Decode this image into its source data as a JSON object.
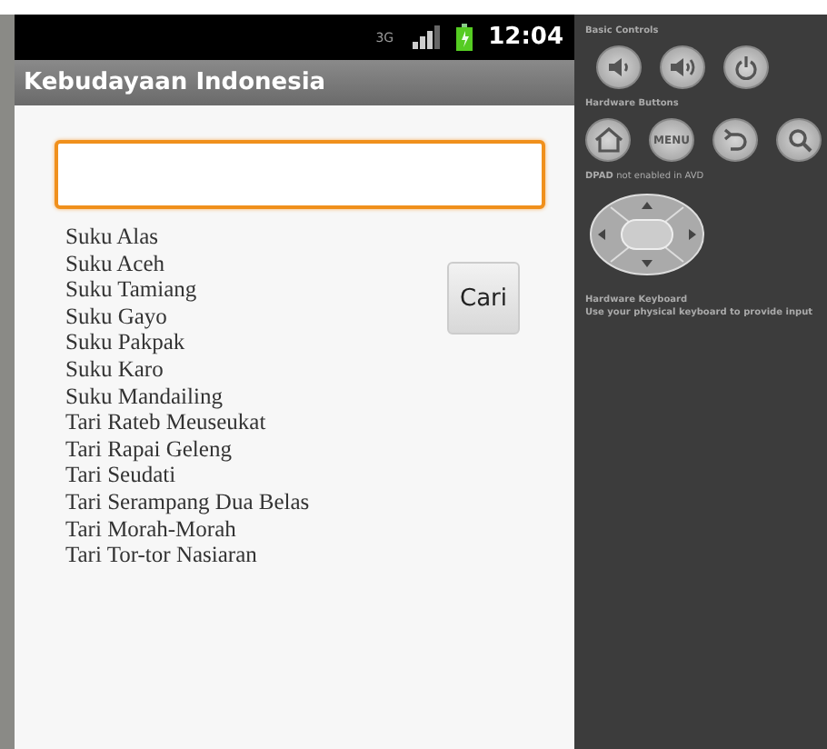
{
  "status_bar": {
    "time": "12:04",
    "network": "3G"
  },
  "app_bar": {
    "title": "Kebudayaan Indonesia"
  },
  "search": {
    "focused": true
  },
  "search_button": {
    "label": "Cari"
  },
  "items": [
    "Suku Alas",
    "Suku Aceh",
    "Suku Tamiang",
    "Suku Gayo",
    "Suku Pakpak",
    "Suku Karo",
    "Suku Mandailing",
    "Tari Rateb Meuseukat",
    "Tari Rapai Geleng",
    "Tari Seudati",
    "Tari Serampang Dua Belas",
    "Tari Morah-Morah",
    "Tari Tor-tor Nasiaran"
  ],
  "controls_panel": {
    "basic_controls": {
      "label": "Basic Controls"
    },
    "hardware_buttons": {
      "label": "Hardware Buttons",
      "menu_label": "MENU"
    },
    "dpad": {
      "label_bold": "DPAD",
      "label_rest": "not enabled in AVD"
    },
    "keyboard": {
      "title": "Hardware Keyboard",
      "note": "Use your physical keyboard to provide input"
    }
  }
}
